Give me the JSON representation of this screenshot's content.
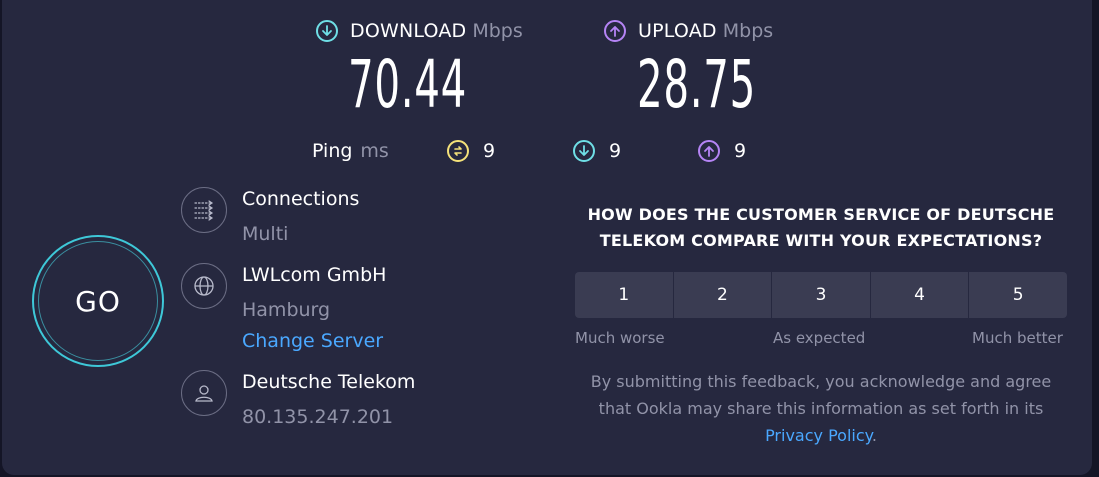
{
  "download": {
    "label": "DOWNLOAD",
    "unit": "Mbps",
    "value": "70.44",
    "icon": "download-icon",
    "color": "#6fdfe6"
  },
  "upload": {
    "label": "UPLOAD",
    "unit": "Mbps",
    "value": "28.75",
    "icon": "upload-icon",
    "color": "#b584f5"
  },
  "ping": {
    "label": "Ping",
    "unit": "ms",
    "idle": {
      "value": "9",
      "icon": "idle-latency-icon",
      "color": "#f5e27a"
    },
    "download": {
      "value": "9",
      "icon": "download-latency-icon",
      "color": "#6fdfe6"
    },
    "upload": {
      "value": "9",
      "icon": "upload-latency-icon",
      "color": "#b584f5"
    }
  },
  "go_button": {
    "label": "GO",
    "color": "#3ec8d8"
  },
  "connections": {
    "title": "Connections",
    "value": "Multi",
    "icon": "connections-icon"
  },
  "server": {
    "title": "LWLcom GmbH",
    "location": "Hamburg",
    "change_label": "Change Server",
    "icon": "globe-icon"
  },
  "provider": {
    "title": "Deutsche Telekom",
    "ip": "80.135.247.201",
    "icon": "user-icon"
  },
  "survey": {
    "question_line1": "HOW DOES THE CUSTOMER SERVICE OF DEUTSCHE",
    "question_line2": "TELEKOM COMPARE WITH YOUR EXPECTATIONS?",
    "options": [
      "1",
      "2",
      "3",
      "4",
      "5"
    ],
    "low_label": "Much worse",
    "mid_label": "As expected",
    "high_label": "Much better",
    "disclaimer_line1": "By submitting this feedback, you acknowledge and agree",
    "disclaimer_line2": "that Ookla may share this information as set forth in its",
    "privacy_link": "Privacy Policy",
    "period": "."
  },
  "colors": {
    "background": "#26283f",
    "link": "#4aa8ff",
    "muted": "#9193a8"
  }
}
